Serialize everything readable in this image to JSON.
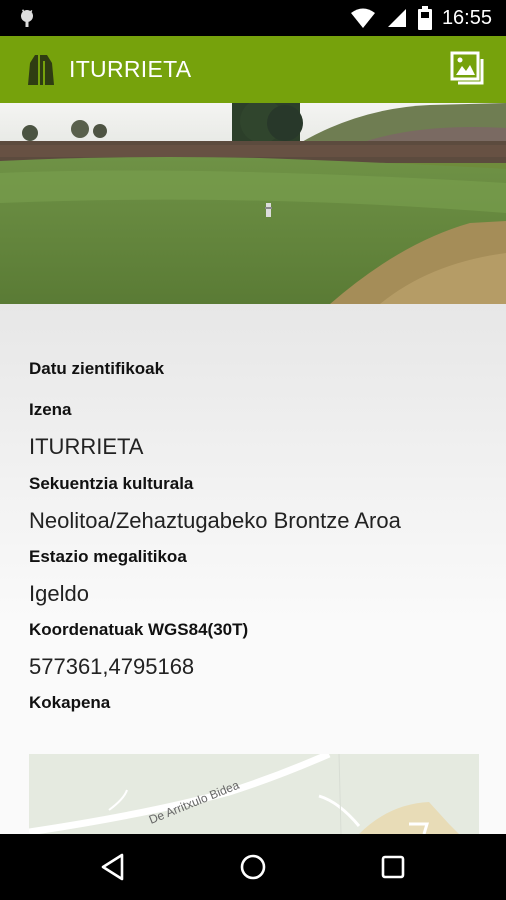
{
  "status_bar": {
    "time": "16:55",
    "icons": [
      "android-icon",
      "wifi-icon",
      "signal-icon",
      "battery-icon"
    ]
  },
  "app_bar": {
    "title": "ITURRIETA",
    "logo_icon": "monument-icon",
    "action_icon": "gallery-icon",
    "color": "#76a20c"
  },
  "details": {
    "section_title": "Datu zientifikoak",
    "fields": [
      {
        "label": "Izena",
        "value": "ITURRIETA"
      },
      {
        "label": "Sekuentzia kulturala",
        "value": "Neolitoa/Zehaztugabeko Brontze Aroa"
      },
      {
        "label": "Estazio megalitikoa",
        "value": "Igeldo"
      },
      {
        "label": "Koordenatuak WGS84(30T)",
        "value": "577361,4795168"
      },
      {
        "label": "Kokapena",
        "value": ""
      }
    ]
  },
  "map": {
    "road_label": "De Arritxulo Bidea"
  },
  "nav_bar": {
    "buttons": [
      "back-icon",
      "home-icon",
      "recents-icon"
    ]
  }
}
